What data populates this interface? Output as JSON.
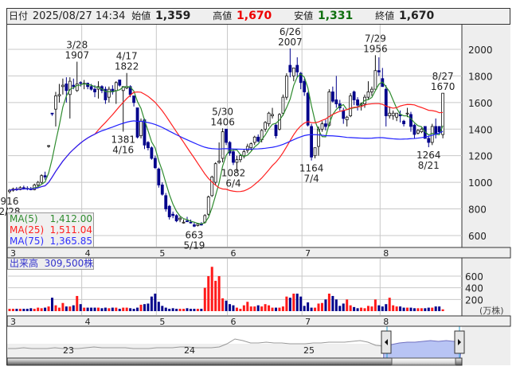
{
  "header": {
    "date_label": "日付",
    "date_value": "2025/08/27 14:34",
    "open_label": "始値",
    "open_value": "1,359",
    "high_label": "高値",
    "high_value": "1,670",
    "low_label": "安値",
    "low_value": "1,331",
    "close_label": "終値",
    "close_value": "1,670"
  },
  "legend": {
    "ma5_label": "MA(5)",
    "ma5_value": "1,412.00",
    "ma25_label": "MA(25)",
    "ma25_value": "1,511.04",
    "ma75_label": "MA(75)",
    "ma75_value": "1,365.85",
    "volume_label": "出来高",
    "volume_value": "309,500株"
  },
  "colors": {
    "up": "#ff1a1a",
    "down": "#00008b",
    "ma5": "#2e8b2e",
    "ma25": "#ff2020",
    "ma75": "#2020ff",
    "grid": "#c8c8c8",
    "panel": "#eeeeee",
    "nav_fill": "#b8c4f4",
    "nav_line": "#7070c0"
  },
  "chart_data": {
    "type": "candlestick",
    "price_axis": {
      "ticks": [
        600,
        800,
        1000,
        1200,
        1400,
        1600,
        1800,
        2000
      ],
      "ylim": [
        520,
        2170
      ]
    },
    "volume_axis": {
      "ticks": [
        200,
        400,
        600
      ],
      "unit": "(万株)",
      "ylim": [
        0,
        900
      ]
    },
    "month_labels": [
      {
        "label": "3",
        "index": 0
      },
      {
        "label": "4",
        "index": 21
      },
      {
        "label": "5",
        "index": 42
      },
      {
        "label": "6",
        "index": 62
      },
      {
        "label": "7",
        "index": 83
      },
      {
        "label": "8",
        "index": 105
      }
    ],
    "navigator_labels": [
      "23",
      "24",
      "25"
    ],
    "annotations": [
      {
        "index": 0,
        "date": "2/28",
        "value": "916",
        "pos": "below"
      },
      {
        "index": 19,
        "date": "3/28",
        "value": "1907",
        "pos": "above"
      },
      {
        "index": 33,
        "date": "4/17",
        "value": "1822",
        "pos": "above"
      },
      {
        "index": 32,
        "date": "4/16",
        "value": "1381",
        "pos": "below"
      },
      {
        "index": 52,
        "date": "5/19",
        "value": "663",
        "pos": "below"
      },
      {
        "index": 60,
        "date": "5/30",
        "value": "1406",
        "pos": "above"
      },
      {
        "index": 63,
        "date": "6/4",
        "value": "1082",
        "pos": "below"
      },
      {
        "index": 79,
        "date": "6/26",
        "value": "2007",
        "pos": "above"
      },
      {
        "index": 85,
        "date": "7/4",
        "value": "1164",
        "pos": "below"
      },
      {
        "index": 103,
        "date": "7/29",
        "value": "1956",
        "pos": "above"
      },
      {
        "index": 118,
        "date": "8/21",
        "value": "1264",
        "pos": "below"
      },
      {
        "index": 122,
        "date": "8/27",
        "value": "1670",
        "pos": "above"
      }
    ],
    "ohlc": [
      [
        930,
        950,
        916,
        940
      ],
      [
        940,
        960,
        930,
        950
      ],
      [
        950,
        965,
        935,
        945
      ],
      [
        945,
        970,
        940,
        960
      ],
      [
        960,
        975,
        945,
        955
      ],
      [
        955,
        970,
        940,
        950
      ],
      [
        950,
        965,
        940,
        945
      ],
      [
        945,
        990,
        940,
        980
      ],
      [
        980,
        1010,
        960,
        1000
      ],
      [
        1000,
        1060,
        990,
        1050
      ],
      [
        1050,
        1080,
        1020,
        1040
      ],
      [
        1270,
        1280,
        1260,
        1276
      ],
      [
        1520,
        1520,
        1500,
        1515
      ],
      [
        1550,
        1680,
        1420,
        1650
      ],
      [
        1650,
        1740,
        1600,
        1660
      ],
      [
        1720,
        1780,
        1660,
        1730
      ],
      [
        1740,
        1790,
        1600,
        1690
      ],
      [
        1660,
        1790,
        1480,
        1760
      ],
      [
        1730,
        1780,
        1700,
        1720
      ],
      [
        1690,
        1907,
        1680,
        1740
      ],
      [
        1750,
        1760,
        1720,
        1748
      ],
      [
        1740,
        1770,
        1700,
        1745
      ],
      [
        1745,
        1750,
        1700,
        1720
      ],
      [
        1720,
        1740,
        1690,
        1700
      ],
      [
        1700,
        1730,
        1640,
        1680
      ],
      [
        1700,
        1760,
        1630,
        1720
      ],
      [
        1720,
        1730,
        1670,
        1690
      ],
      [
        1700,
        1720,
        1590,
        1620
      ],
      [
        1640,
        1720,
        1600,
        1700
      ],
      [
        1700,
        1730,
        1660,
        1680
      ],
      [
        1690,
        1760,
        1590,
        1750
      ],
      [
        1770,
        1770,
        1720,
        1730
      ],
      [
        1690,
        1720,
        1381,
        1720
      ],
      [
        1710,
        1822,
        1700,
        1720
      ],
      [
        1720,
        1730,
        1640,
        1660
      ],
      [
        1650,
        1650,
        1570,
        1600
      ],
      [
        1560,
        1560,
        1330,
        1340
      ],
      [
        1350,
        1480,
        1330,
        1460
      ],
      [
        1470,
        1480,
        1250,
        1280
      ],
      [
        1300,
        1310,
        1240,
        1260
      ],
      [
        1260,
        1270,
        1170,
        1180
      ],
      [
        1180,
        1200,
        1100,
        1110
      ],
      [
        1100,
        1110,
        960,
        980
      ],
      [
        980,
        1000,
        900,
        910
      ],
      [
        900,
        920,
        780,
        800
      ],
      [
        820,
        830,
        720,
        740
      ],
      [
        760,
        780,
        730,
        750
      ],
      [
        750,
        760,
        700,
        710
      ],
      [
        720,
        740,
        700,
        730
      ],
      [
        700,
        720,
        690,
        700
      ],
      [
        710,
        740,
        700,
        705
      ],
      [
        700,
        720,
        690,
        695
      ],
      [
        680,
        700,
        663,
        670
      ],
      [
        675,
        690,
        668,
        685
      ],
      [
        685,
        700,
        675,
        680
      ],
      [
        700,
        760,
        690,
        750
      ],
      [
        760,
        900,
        750,
        890
      ],
      [
        900,
        1050,
        890,
        1040
      ],
      [
        1000,
        1150,
        980,
        1140
      ],
      [
        1150,
        1300,
        1140,
        1160
      ],
      [
        1180,
        1406,
        1150,
        1380
      ],
      [
        1400,
        1400,
        1280,
        1300
      ],
      [
        1300,
        1310,
        1200,
        1220
      ],
      [
        1230,
        1250,
        1130,
        1150
      ],
      [
        1150,
        1200,
        1082,
        1170
      ],
      [
        1170,
        1210,
        1150,
        1200
      ],
      [
        1200,
        1250,
        1180,
        1230
      ],
      [
        1240,
        1290,
        1220,
        1270
      ],
      [
        1260,
        1300,
        1240,
        1290
      ],
      [
        1300,
        1350,
        1280,
        1340
      ],
      [
        1340,
        1360,
        1300,
        1310
      ],
      [
        1320,
        1400,
        1300,
        1390
      ],
      [
        1400,
        1460,
        1380,
        1450
      ],
      [
        1440,
        1530,
        1420,
        1520
      ],
      [
        1500,
        1560,
        1480,
        1510
      ],
      [
        1430,
        1440,
        1330,
        1350
      ],
      [
        1400,
        1520,
        1390,
        1510
      ],
      [
        1520,
        1660,
        1500,
        1640
      ],
      [
        1640,
        1820,
        1620,
        1800
      ],
      [
        1880,
        2007,
        1790,
        1830
      ],
      [
        1800,
        1860,
        1760,
        1860
      ],
      [
        1880,
        1940,
        1790,
        1830
      ],
      [
        1820,
        1830,
        1700,
        1750
      ],
      [
        1760,
        1780,
        1650,
        1680
      ],
      [
        1670,
        1680,
        1420,
        1430
      ],
      [
        1420,
        1440,
        1164,
        1190
      ],
      [
        1200,
        1260,
        1180,
        1260
      ],
      [
        1270,
        1420,
        1200,
        1400
      ],
      [
        1400,
        1460,
        1380,
        1440
      ],
      [
        1440,
        1470,
        1390,
        1420
      ],
      [
        1430,
        1700,
        1420,
        1680
      ],
      [
        1680,
        1720,
        1600,
        1610
      ],
      [
        1620,
        1800,
        1560,
        1590
      ],
      [
        1590,
        1620,
        1540,
        1560
      ],
      [
        1540,
        1560,
        1440,
        1480
      ],
      [
        1470,
        1500,
        1420,
        1490
      ],
      [
        1500,
        1670,
        1490,
        1650
      ],
      [
        1680,
        1690,
        1580,
        1620
      ],
      [
        1620,
        1640,
        1540,
        1580
      ],
      [
        1580,
        1600,
        1540,
        1590
      ],
      [
        1590,
        1660,
        1560,
        1640
      ],
      [
        1640,
        1760,
        1620,
        1680
      ],
      [
        1680,
        1720,
        1650,
        1700
      ],
      [
        1700,
        1956,
        1700,
        1840
      ],
      [
        1840,
        1940,
        1800,
        1830
      ],
      [
        1780,
        1860,
        1720,
        1720
      ],
      [
        1700,
        1730,
        1420,
        1500
      ],
      [
        1500,
        1570,
        1480,
        1520
      ],
      [
        1500,
        1540,
        1470,
        1520
      ],
      [
        1490,
        1520,
        1460,
        1520
      ],
      [
        1510,
        1540,
        1450,
        1500
      ],
      [
        1460,
        1470,
        1420,
        1440
      ],
      [
        1520,
        1560,
        1490,
        1520
      ],
      [
        1510,
        1530,
        1380,
        1420
      ],
      [
        1430,
        1440,
        1330,
        1360
      ],
      [
        1370,
        1400,
        1360,
        1390
      ],
      [
        1380,
        1410,
        1370,
        1400
      ],
      [
        1420,
        1420,
        1330,
        1330
      ],
      [
        1330,
        1350,
        1264,
        1300
      ],
      [
        1300,
        1440,
        1280,
        1420
      ],
      [
        1420,
        1480,
        1330,
        1360
      ],
      [
        1420,
        1420,
        1370,
        1380
      ],
      [
        1359,
        1670,
        1331,
        1670
      ]
    ],
    "volume": [
      40,
      40,
      40,
      40,
      40,
      40,
      50,
      40,
      60,
      50,
      60,
      80,
      230,
      100,
      60,
      140,
      80,
      80,
      100,
      260,
      120,
      60,
      60,
      60,
      60,
      60,
      50,
      60,
      50,
      60,
      60,
      40,
      60,
      60,
      50,
      40,
      60,
      110,
      120,
      130,
      250,
      300,
      160,
      90,
      60,
      40,
      50,
      40,
      40,
      40,
      50,
      40,
      40,
      40,
      40,
      400,
      600,
      760,
      520,
      600,
      220,
      180,
      120,
      100,
      60,
      40,
      100,
      160,
      80,
      80,
      100,
      80,
      120,
      100,
      60,
      60,
      60,
      80,
      250,
      230,
      300,
      300,
      250,
      90,
      150,
      60,
      60,
      130,
      140,
      200,
      300,
      260,
      200,
      90,
      130,
      200,
      100,
      70,
      50,
      60,
      50,
      90,
      80,
      200,
      100,
      80,
      120,
      230,
      100,
      80,
      80,
      60,
      60,
      60,
      50,
      50,
      50,
      50,
      60,
      60,
      80,
      80,
      31
    ],
    "navigator_series": [
      30,
      30,
      31,
      30,
      30,
      30,
      31,
      30,
      30,
      30,
      31,
      32,
      31,
      31,
      31,
      31,
      30,
      30,
      30,
      31,
      31,
      31,
      32,
      32,
      31,
      31,
      31,
      32,
      36,
      42,
      40,
      37,
      37,
      38,
      37,
      37,
      36,
      36,
      36,
      37,
      37,
      38,
      38,
      38,
      39,
      40,
      38,
      34,
      33,
      35,
      37,
      38,
      38,
      39,
      40,
      39,
      40,
      39,
      38
    ]
  }
}
